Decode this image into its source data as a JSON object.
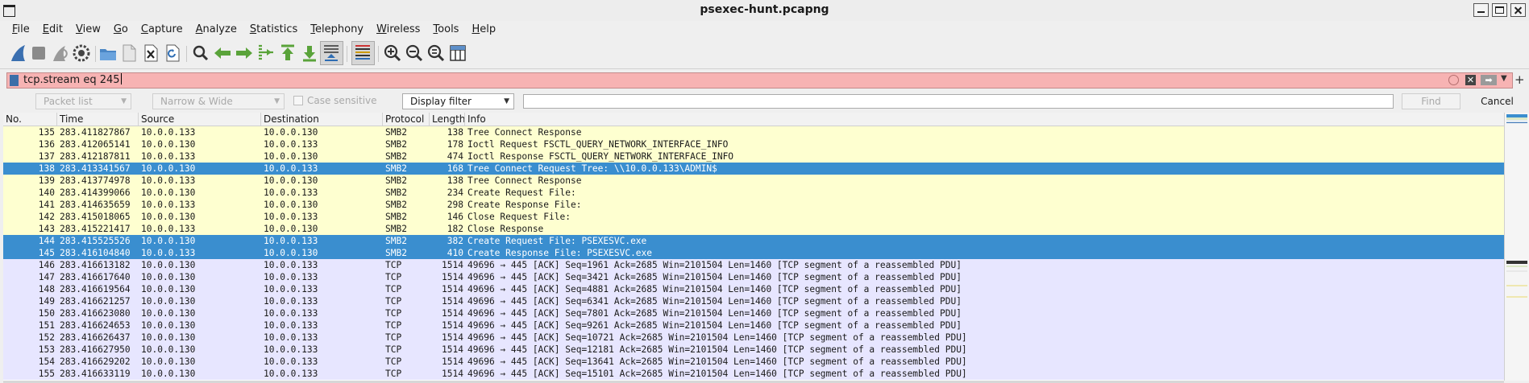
{
  "window": {
    "title": "psexec-hunt.pcapng"
  },
  "menu": [
    "File",
    "Edit",
    "View",
    "Go",
    "Capture",
    "Analyze",
    "Statistics",
    "Telephony",
    "Wireless",
    "Tools",
    "Help"
  ],
  "toolbar": {
    "icons": [
      "shark-fin-start-icon",
      "stop-capture-icon",
      "restart-capture-icon",
      "capture-options-icon",
      "open-file-icon",
      "save-file-icon",
      "close-file-icon",
      "reload-file-icon",
      "find-packet-icon",
      "go-back-icon",
      "go-forward-icon",
      "go-to-packet-icon",
      "first-packet-icon",
      "last-packet-icon",
      "autoscroll-icon",
      "colorize-icon",
      "zoom-in-icon",
      "zoom-out-icon",
      "zoom-normal-icon",
      "resize-columns-icon"
    ]
  },
  "display_filter": {
    "value": "tcp.stream eq 245"
  },
  "find_bar": {
    "search_in": "Packet list",
    "char_width": "Narrow & Wide",
    "case_sensitive_label": "Case sensitive",
    "search_type": "Display filter",
    "find_label": "Find",
    "cancel_label": "Cancel"
  },
  "packet_list": {
    "columns": [
      "No.",
      "Time",
      "Source",
      "Destination",
      "Protocol",
      "Length",
      "Info"
    ],
    "rows": [
      {
        "no": "135",
        "time": "283.411827867",
        "src": "10.0.0.133",
        "dst": "10.0.0.130",
        "proto": "SMB2",
        "len": "138",
        "info": "Tree Connect Response",
        "style": "smb"
      },
      {
        "no": "136",
        "time": "283.412065141",
        "src": "10.0.0.130",
        "dst": "10.0.0.133",
        "proto": "SMB2",
        "len": "178",
        "info": "Ioctl Request FSCTL_QUERY_NETWORK_INTERFACE_INFO",
        "style": "smb"
      },
      {
        "no": "137",
        "time": "283.412187811",
        "src": "10.0.0.133",
        "dst": "10.0.0.130",
        "proto": "SMB2",
        "len": "474",
        "info": "Ioctl Response FSCTL_QUERY_NETWORK_INTERFACE_INFO",
        "style": "smb"
      },
      {
        "no": "138",
        "time": "283.413341567",
        "src": "10.0.0.130",
        "dst": "10.0.0.133",
        "proto": "SMB2",
        "len": "168",
        "info": "Tree Connect Request Tree: \\\\10.0.0.133\\ADMIN$",
        "style": "selected"
      },
      {
        "no": "139",
        "time": "283.413774978",
        "src": "10.0.0.133",
        "dst": "10.0.0.130",
        "proto": "SMB2",
        "len": "138",
        "info": "Tree Connect Response",
        "style": "smb"
      },
      {
        "no": "140",
        "time": "283.414399066",
        "src": "10.0.0.130",
        "dst": "10.0.0.133",
        "proto": "SMB2",
        "len": "234",
        "info": "Create Request File:",
        "style": "smb"
      },
      {
        "no": "141",
        "time": "283.414635659",
        "src": "10.0.0.133",
        "dst": "10.0.0.130",
        "proto": "SMB2",
        "len": "298",
        "info": "Create Response File:",
        "style": "smb"
      },
      {
        "no": "142",
        "time": "283.415018065",
        "src": "10.0.0.130",
        "dst": "10.0.0.133",
        "proto": "SMB2",
        "len": "146",
        "info": "Close Request File:",
        "style": "smb"
      },
      {
        "no": "143",
        "time": "283.415221417",
        "src": "10.0.0.133",
        "dst": "10.0.0.130",
        "proto": "SMB2",
        "len": "182",
        "info": "Close Response",
        "style": "smb"
      },
      {
        "no": "144",
        "time": "283.415525526",
        "src": "10.0.0.130",
        "dst": "10.0.0.133",
        "proto": "SMB2",
        "len": "382",
        "info": "Create Request File: PSEXESVC.exe",
        "style": "selected"
      },
      {
        "no": "145",
        "time": "283.416104840",
        "src": "10.0.0.133",
        "dst": "10.0.0.130",
        "proto": "SMB2",
        "len": "410",
        "info": "Create Response File: PSEXESVC.exe",
        "style": "selected"
      },
      {
        "no": "146",
        "time": "283.416613182",
        "src": "10.0.0.130",
        "dst": "10.0.0.133",
        "proto": "TCP",
        "len": "1514",
        "info": "49696 → 445 [ACK] Seq=1961 Ack=2685 Win=2101504 Len=1460 [TCP segment of a reassembled PDU]",
        "style": "tcp"
      },
      {
        "no": "147",
        "time": "283.416617640",
        "src": "10.0.0.130",
        "dst": "10.0.0.133",
        "proto": "TCP",
        "len": "1514",
        "info": "49696 → 445 [ACK] Seq=3421 Ack=2685 Win=2101504 Len=1460 [TCP segment of a reassembled PDU]",
        "style": "tcp"
      },
      {
        "no": "148",
        "time": "283.416619564",
        "src": "10.0.0.130",
        "dst": "10.0.0.133",
        "proto": "TCP",
        "len": "1514",
        "info": "49696 → 445 [ACK] Seq=4881 Ack=2685 Win=2101504 Len=1460 [TCP segment of a reassembled PDU]",
        "style": "tcp"
      },
      {
        "no": "149",
        "time": "283.416621257",
        "src": "10.0.0.130",
        "dst": "10.0.0.133",
        "proto": "TCP",
        "len": "1514",
        "info": "49696 → 445 [ACK] Seq=6341 Ack=2685 Win=2101504 Len=1460 [TCP segment of a reassembled PDU]",
        "style": "tcp"
      },
      {
        "no": "150",
        "time": "283.416623080",
        "src": "10.0.0.130",
        "dst": "10.0.0.133",
        "proto": "TCP",
        "len": "1514",
        "info": "49696 → 445 [ACK] Seq=7801 Ack=2685 Win=2101504 Len=1460 [TCP segment of a reassembled PDU]",
        "style": "tcp"
      },
      {
        "no": "151",
        "time": "283.416624653",
        "src": "10.0.0.130",
        "dst": "10.0.0.133",
        "proto": "TCP",
        "len": "1514",
        "info": "49696 → 445 [ACK] Seq=9261 Ack=2685 Win=2101504 Len=1460 [TCP segment of a reassembled PDU]",
        "style": "tcp"
      },
      {
        "no": "152",
        "time": "283.416626437",
        "src": "10.0.0.130",
        "dst": "10.0.0.133",
        "proto": "TCP",
        "len": "1514",
        "info": "49696 → 445 [ACK] Seq=10721 Ack=2685 Win=2101504 Len=1460 [TCP segment of a reassembled PDU]",
        "style": "tcp"
      },
      {
        "no": "153",
        "time": "283.416627950",
        "src": "10.0.0.130",
        "dst": "10.0.0.133",
        "proto": "TCP",
        "len": "1514",
        "info": "49696 → 445 [ACK] Seq=12181 Ack=2685 Win=2101504 Len=1460 [TCP segment of a reassembled PDU]",
        "style": "tcp"
      },
      {
        "no": "154",
        "time": "283.416629202",
        "src": "10.0.0.130",
        "dst": "10.0.0.133",
        "proto": "TCP",
        "len": "1514",
        "info": "49696 → 445 [ACK] Seq=13641 Ack=2685 Win=2101504 Len=1460 [TCP segment of a reassembled PDU]",
        "style": "tcp"
      },
      {
        "no": "155",
        "time": "283.416633119",
        "src": "10.0.0.130",
        "dst": "10.0.0.133",
        "proto": "TCP",
        "len": "1514",
        "info": "49696 → 445 [ACK] Seq=15101 Ack=2685 Win=2101504 Len=1460 [TCP segment of a reassembled PDU]",
        "style": "tcp"
      }
    ]
  },
  "colors": {
    "smb_row_bg": "#feffd0",
    "tcp_row_bg": "#e7e6ff",
    "selected_bg": "#3a8ecf",
    "selected_fg": "#ffffff",
    "filter_bg": "#f7b3b3"
  }
}
